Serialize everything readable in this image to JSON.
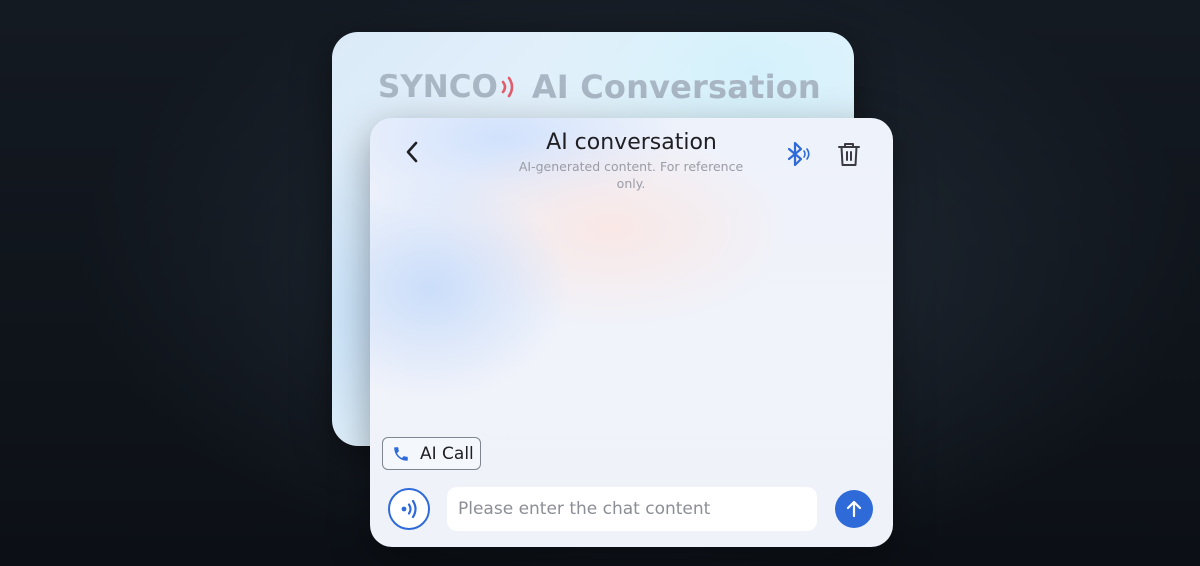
{
  "background_card": {
    "brand": "SYNCO",
    "title": "AI Conversation"
  },
  "chat": {
    "title": "AI conversation",
    "subtitle": "AI-generated content. For reference only.",
    "ai_call_label": "AI Call",
    "input_placeholder": "Please enter the chat content",
    "input_value": ""
  },
  "icons": {
    "back": "chevron-left-icon",
    "bluetooth": "bluetooth-icon",
    "delete": "trash-icon",
    "call": "phone-icon",
    "voice": "voice-waves-icon",
    "send": "arrow-up-icon"
  },
  "colors": {
    "accent": "#2e6bd8",
    "brand_waves": "#e25c6a",
    "background_title": "#a9b6c4"
  }
}
